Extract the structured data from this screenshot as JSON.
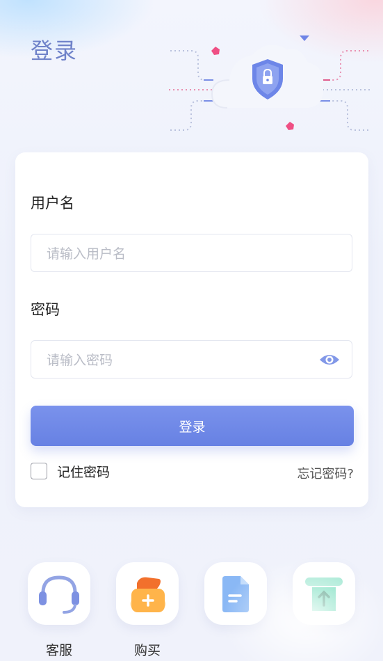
{
  "header": {
    "title": "登录"
  },
  "form": {
    "username": {
      "label": "用户名",
      "placeholder": "请输入用户名",
      "value": ""
    },
    "password": {
      "label": "密码",
      "placeholder": "请输入密码",
      "value": ""
    },
    "login_button": "登录",
    "remember_label": "记住密码",
    "remember_checked": false,
    "forgot_link": "忘记密码?"
  },
  "bottom_nav": [
    {
      "label": "客服",
      "icon": "headset-icon"
    },
    {
      "label": "购买",
      "icon": "shopping-bag-icon"
    },
    {
      "label": "",
      "icon": "document-icon"
    },
    {
      "label": "",
      "icon": "upload-icon"
    }
  ],
  "colors": {
    "accent": "#6f84e6",
    "title": "#6f82c9",
    "background": "#eef1fb"
  }
}
